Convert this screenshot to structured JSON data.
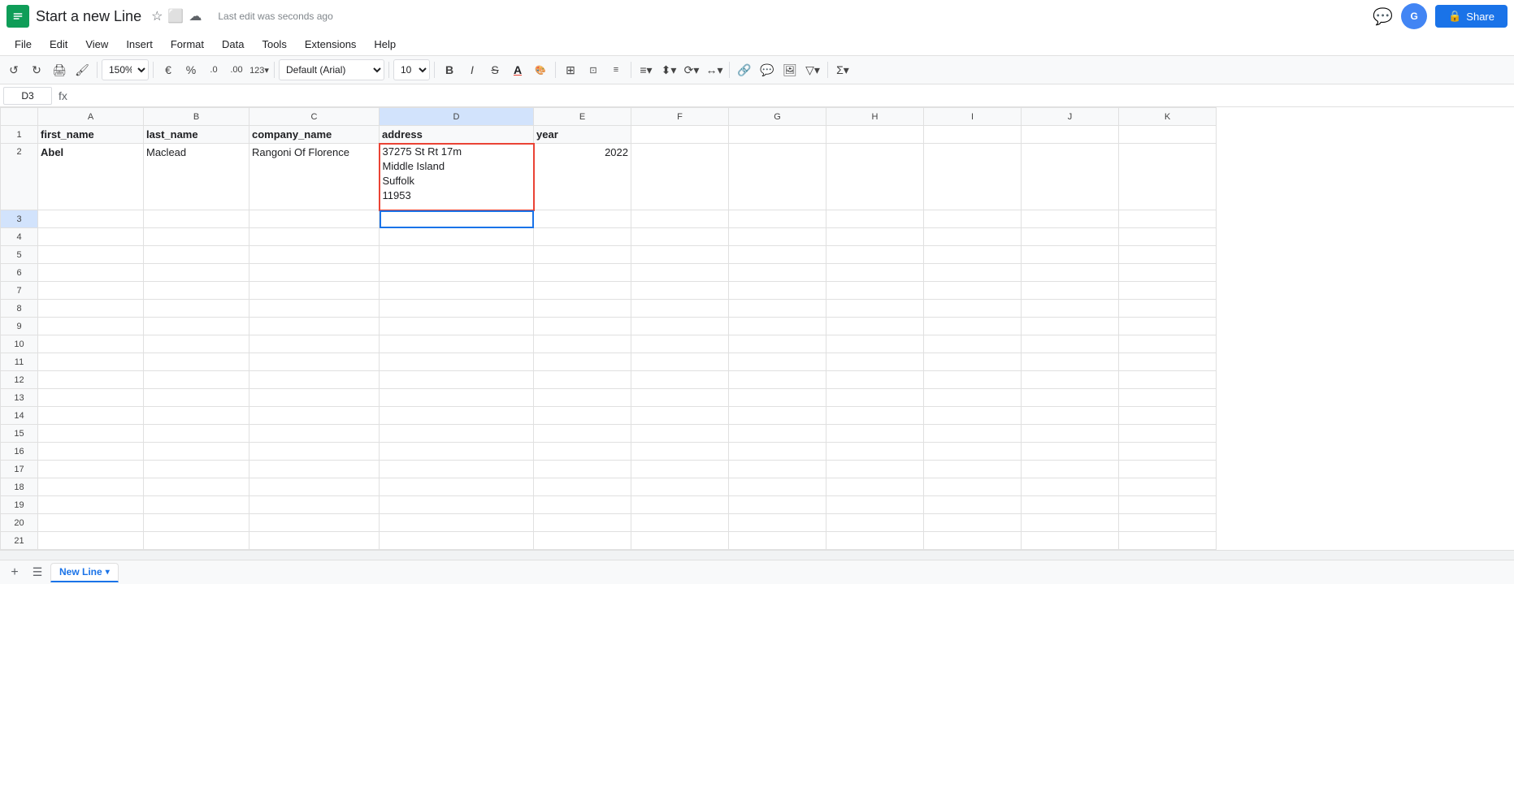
{
  "titlebar": {
    "app_logo_alt": "Google Sheets",
    "doc_title": "Start a new Line",
    "last_edit": "Last edit was seconds ago",
    "share_label": "Share"
  },
  "menubar": {
    "items": [
      "File",
      "Edit",
      "View",
      "Insert",
      "Format",
      "Data",
      "Tools",
      "Extensions",
      "Help"
    ]
  },
  "toolbar": {
    "zoom": "150%",
    "font_family": "Default (Ari...",
    "font_size": "10",
    "currency_symbol": "€",
    "percent_symbol": "%",
    "decimal_decrease": ".0",
    "decimal_increase": ".00",
    "more_formats": "123"
  },
  "formula_bar": {
    "cell_ref": "D3",
    "formula_icon": "fx",
    "formula_value": ""
  },
  "columns": {
    "headers": [
      "",
      "A",
      "B",
      "C",
      "D",
      "E",
      "F",
      "G",
      "H",
      "I",
      "J",
      "K"
    ]
  },
  "rows": {
    "header_row": {
      "first_name": "first_name",
      "last_name": "last_name",
      "company_name": "company_name",
      "address": "address",
      "year": "year"
    },
    "data_row2": {
      "first_name": "Abel",
      "last_name": "Maclead",
      "company_name": "Rangoni Of Florence",
      "address": "37275 St Rt 17m\nMiddle Island\nSuffolk\n11953",
      "year": "2022"
    }
  },
  "tabs": {
    "active_tab": "New Line",
    "add_label": "+",
    "list_label": "☰"
  },
  "colors": {
    "selected_cell_border": "#1a73e8",
    "address_cell_border": "#ea4335",
    "header_bg": "#f8f9fa",
    "active_tab_color": "#188038"
  }
}
